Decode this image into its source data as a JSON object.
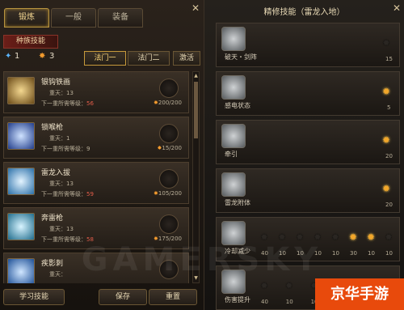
{
  "left": {
    "tabs": [
      {
        "label": "锻炼"
      },
      {
        "label": "一般"
      },
      {
        "label": "装备"
      }
    ],
    "section_title": "种族技能",
    "points": {
      "stars": "1",
      "gold": "3"
    },
    "buttons": {
      "mode1": "法门一",
      "mode2": "法门二",
      "activate": "激活"
    },
    "skills": [
      {
        "name": "银钩铁画",
        "lvl_label": "重天：13",
        "need_label": "下一重所需等级：",
        "need_value": "56",
        "progress": "200/200",
        "color": "#c8a040"
      },
      {
        "name": "锁喉枪",
        "lvl_label": "重天：1",
        "need_label": "下一重所需等级：",
        "need_value": "9",
        "progress": "15/200",
        "color": "#4f7de0"
      },
      {
        "name": "雷龙入拔",
        "lvl_label": "重天：13",
        "need_label": "下一重所需等级：",
        "need_value": "59",
        "progress": "105/200",
        "color": "#5aa8e6"
      },
      {
        "name": "奔雷枪",
        "lvl_label": "重天：13",
        "need_label": "下一重所需等级：",
        "need_value": "58",
        "progress": "175/200",
        "color": "#48b8d8"
      },
      {
        "name": "疾影刺",
        "lvl_label": "重天：",
        "need_label": "",
        "need_value": "",
        "progress": "",
        "color": "#3f86d6"
      }
    ],
    "bottom": {
      "learn": "学习技能",
      "save": "保存",
      "reset": "重置"
    }
  },
  "right": {
    "title": "精修技能（雷龙入地）",
    "panels": [
      {
        "name": "破天・剑阵",
        "end_value": "15",
        "lit": false
      },
      {
        "name": "感电状态",
        "end_value": "5",
        "lit": true
      },
      {
        "name": "牵引",
        "end_value": "20",
        "lit": true
      },
      {
        "name": "雷龙附体",
        "end_value": "20",
        "lit": true
      },
      {
        "name": "冷却减少",
        "values": [
          "40",
          "10",
          "10",
          "10",
          "10",
          "30",
          "10",
          "10"
        ],
        "lit": [
          false,
          false,
          false,
          false,
          false,
          true,
          true,
          false
        ]
      },
      {
        "name": "伤害提升",
        "values": [
          "40",
          "10",
          "10",
          "10",
          "10",
          "10"
        ],
        "lit": [
          false,
          false,
          false,
          false,
          false,
          false
        ]
      }
    ]
  },
  "watermark": "GAMERSKY",
  "logo": "京华手游"
}
